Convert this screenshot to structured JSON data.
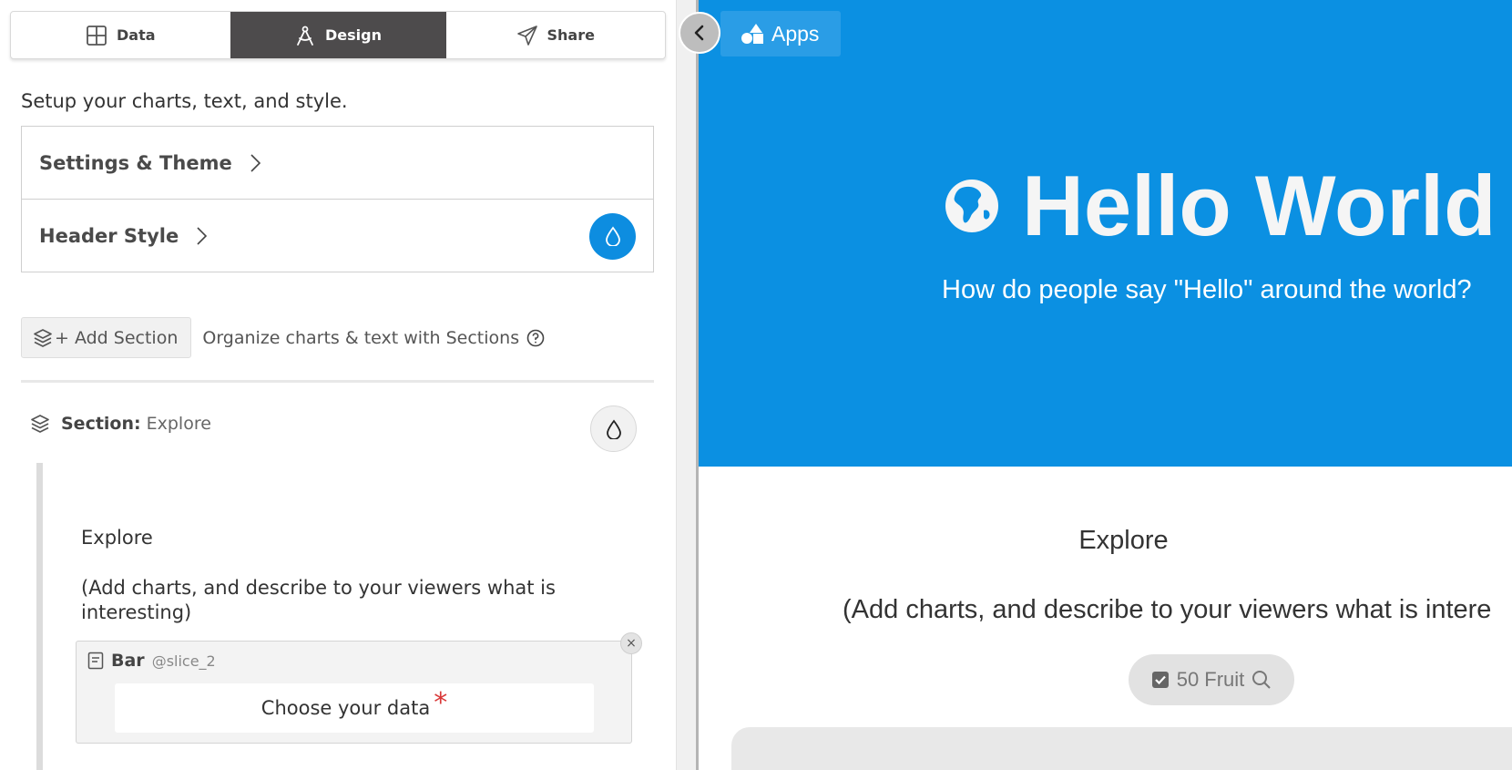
{
  "tabs": [
    {
      "label": "Data",
      "icon": "table-grid-icon"
    },
    {
      "label": "Design",
      "icon": "drafting-compass-icon",
      "active": true
    },
    {
      "label": "Share",
      "icon": "paper-plane-icon"
    }
  ],
  "editor": {
    "intro": "Setup your charts, text, and style.",
    "menu": [
      {
        "label": "Settings & Theme"
      },
      {
        "label": "Header Style"
      }
    ],
    "add_section_label": "+ Add Section",
    "organize_text": "Organize charts & text with Sections",
    "section": {
      "prefix": "Section:",
      "name": "Explore",
      "title": "Explore",
      "description": "(Add charts, and describe to your viewers what is interesting)"
    },
    "chart_card": {
      "type_label": "Bar",
      "slice": "@slice_2",
      "choose_label": "Choose your data",
      "required_mark": "*",
      "close_label": "×"
    }
  },
  "preview": {
    "apps_label": "Apps",
    "title": "Hello World",
    "subtitle": "How do people say \"Hello\" around the world?",
    "section_title": "Explore",
    "section_description": "(Add charts, and describe to your viewers what is intere",
    "filter_label": "50 Fruit"
  },
  "colors": {
    "accent": "#0b90e2",
    "active_tab": "#4d4b4c",
    "required": "#d93838"
  }
}
